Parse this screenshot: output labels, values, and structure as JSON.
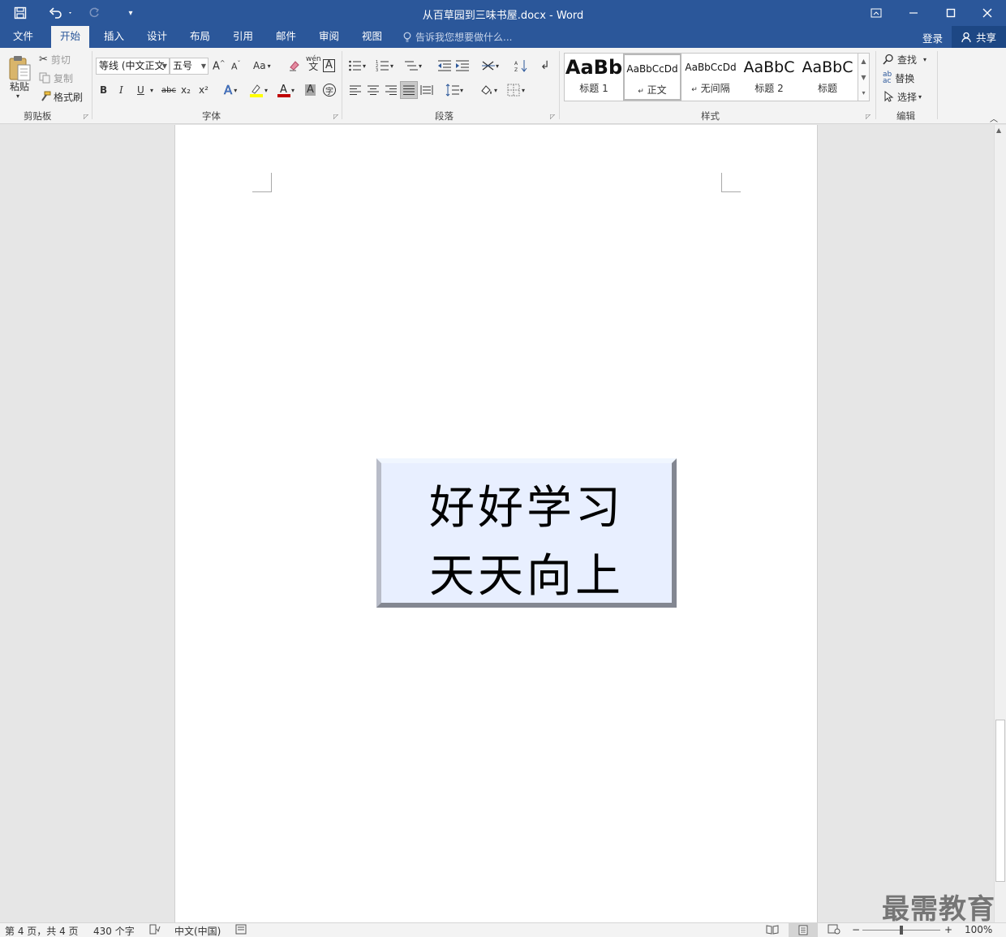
{
  "window": {
    "title": "从百草园到三味书屋.docx - Word"
  },
  "tabs": [
    "文件",
    "开始",
    "插入",
    "设计",
    "布局",
    "引用",
    "邮件",
    "审阅",
    "视图"
  ],
  "tell_me": "告诉我您想要做什么...",
  "account": {
    "login": "登录",
    "share": "共享"
  },
  "clipboard": {
    "paste": "粘贴",
    "cut": "剪切",
    "copy": "复制",
    "format_painter": "格式刷",
    "label": "剪贴板"
  },
  "font": {
    "name": "等线 (中文正文",
    "size": "五号",
    "label": "字体",
    "case": "Aa",
    "bold": "B",
    "italic": "I",
    "underline": "U",
    "strike": "abc",
    "sub": "x₂",
    "sup": "x²"
  },
  "paragraph": {
    "label": "段落"
  },
  "styles": {
    "label": "样式",
    "items": [
      {
        "preview": "AaBb",
        "name": "标题 1"
      },
      {
        "preview": "AaBbCcDd",
        "name": "正文"
      },
      {
        "preview": "AaBbCcDd",
        "name": "无间隔"
      },
      {
        "preview": "AaBbC",
        "name": "标题 2"
      },
      {
        "preview": "AaBbC",
        "name": "标题"
      }
    ]
  },
  "editing": {
    "find": "查找",
    "replace": "替换",
    "select": "选择",
    "label": "编辑"
  },
  "document": {
    "line1": "好好学习",
    "line2": "天天向上"
  },
  "status": {
    "page": "第 4 页，共 4 页",
    "words": "430 个字",
    "language": "中文(中国)",
    "zoom": "100%"
  },
  "watermark": "最需教育"
}
